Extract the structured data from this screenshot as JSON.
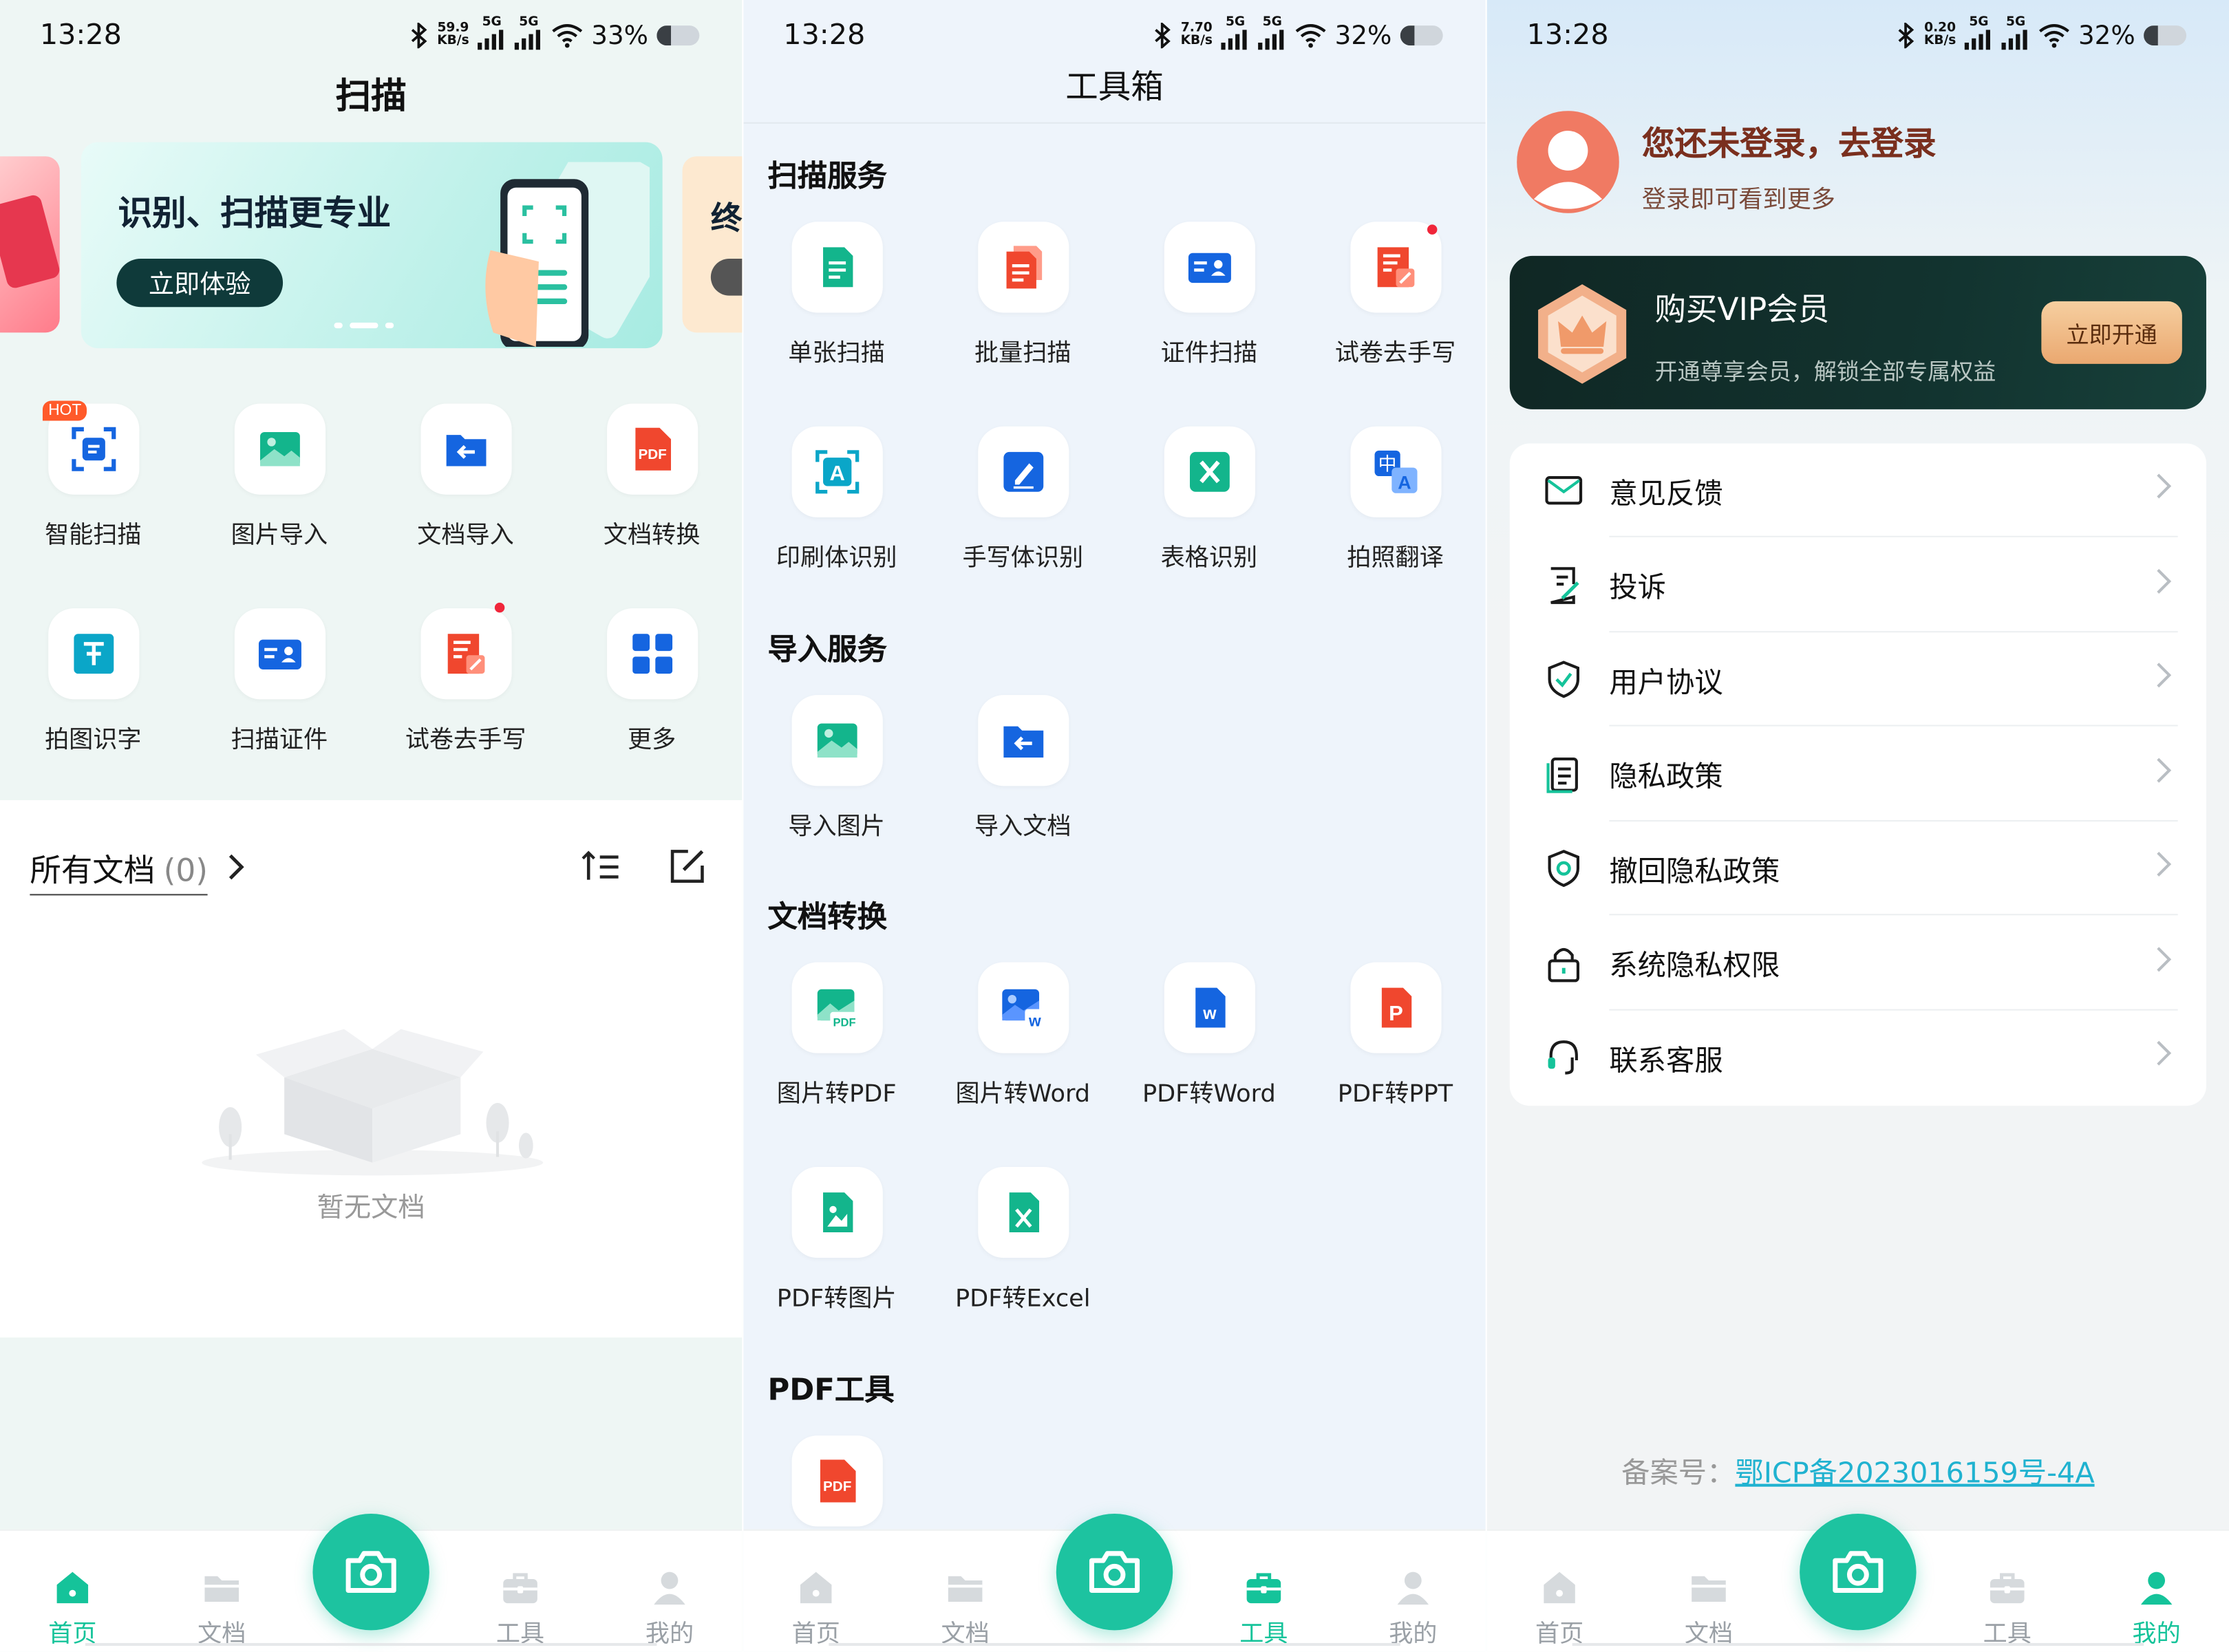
{
  "colors": {
    "accent": "#15c39a",
    "camera": "#1dc3a0",
    "vip_bg": "#0f2e2d",
    "vip_btn": "#f0c08a",
    "link": "#20b2d0"
  },
  "status_bars": [
    {
      "time": "13:28",
      "speed_top": "59.9",
      "speed_unit": "KB/s",
      "net1": "5G",
      "net2": "5G",
      "battery": "33%",
      "battery_level": 0.33
    },
    {
      "time": "13:28",
      "speed_top": "7.70",
      "speed_unit": "KB/s",
      "net1": "5G",
      "net2": "5G",
      "battery": "32%",
      "battery_level": 0.32
    },
    {
      "time": "13:28",
      "speed_top": "0.20",
      "speed_unit": "KB/s",
      "net1": "5G",
      "net2": "5G",
      "battery": "32%",
      "battery_level": 0.32
    }
  ],
  "scan_page": {
    "title": "扫描",
    "banner": {
      "headline": "识别、扫描更专业",
      "button": "立即体验",
      "next_card_char": "终"
    },
    "hot_badge": "HOT",
    "grid": [
      {
        "label": "智能扫描",
        "icon": "smart-scan-icon"
      },
      {
        "label": "图片导入",
        "icon": "image-import-icon"
      },
      {
        "label": "文档导入",
        "icon": "document-import-icon"
      },
      {
        "label": "文档转换",
        "icon": "pdf-convert-icon"
      },
      {
        "label": "拍图识字",
        "icon": "text-recognition-icon"
      },
      {
        "label": "扫描证件",
        "icon": "id-card-icon"
      },
      {
        "label": "试卷去手写",
        "icon": "exam-erase-icon"
      },
      {
        "label": "更多",
        "icon": "more-grid-icon"
      }
    ],
    "docs": {
      "title": "所有文档",
      "count": "(0)",
      "empty_text": "暂无文档"
    }
  },
  "toolbox_page": {
    "title": "工具箱",
    "sections": [
      {
        "title": "扫描服务",
        "items": [
          "单张扫描",
          "批量扫描",
          "证件扫描",
          "试卷去手写",
          "印刷体识别",
          "手写体识别",
          "表格识别",
          "拍照翻译"
        ]
      },
      {
        "title": "导入服务",
        "items": [
          "导入图片",
          "导入文档"
        ]
      },
      {
        "title": "文档转换",
        "items": [
          "图片转PDF",
          "图片转Word",
          "PDF转Word",
          "PDF转PPT",
          "PDF转图片",
          "PDF转Excel"
        ]
      },
      {
        "title": "PDF工具",
        "items": []
      }
    ]
  },
  "profile_page": {
    "login_title": "您还未登录，去登录",
    "login_sub": "登录即可看到更多",
    "vip": {
      "title": "购买VIP会员",
      "subtitle": "开通尊享会员，解锁全部专属权益",
      "button": "立即开通"
    },
    "menu": [
      {
        "label": "意见反馈",
        "icon": "mail-icon"
      },
      {
        "label": "投诉",
        "icon": "complaint-icon"
      },
      {
        "label": "用户协议",
        "icon": "shield-check-icon"
      },
      {
        "label": "隐私政策",
        "icon": "document-list-icon"
      },
      {
        "label": "撤回隐私政策",
        "icon": "shield-withdraw-icon"
      },
      {
        "label": "系统隐私权限",
        "icon": "lock-icon"
      },
      {
        "label": "联系客服",
        "icon": "headset-icon"
      }
    ],
    "icp_label": "备案号：",
    "icp_number": "鄂ICP备2023016159号-4A"
  },
  "tabbar": {
    "tabs": [
      "首页",
      "文档",
      "工具",
      "我的"
    ],
    "active": [
      0,
      2,
      3
    ]
  }
}
